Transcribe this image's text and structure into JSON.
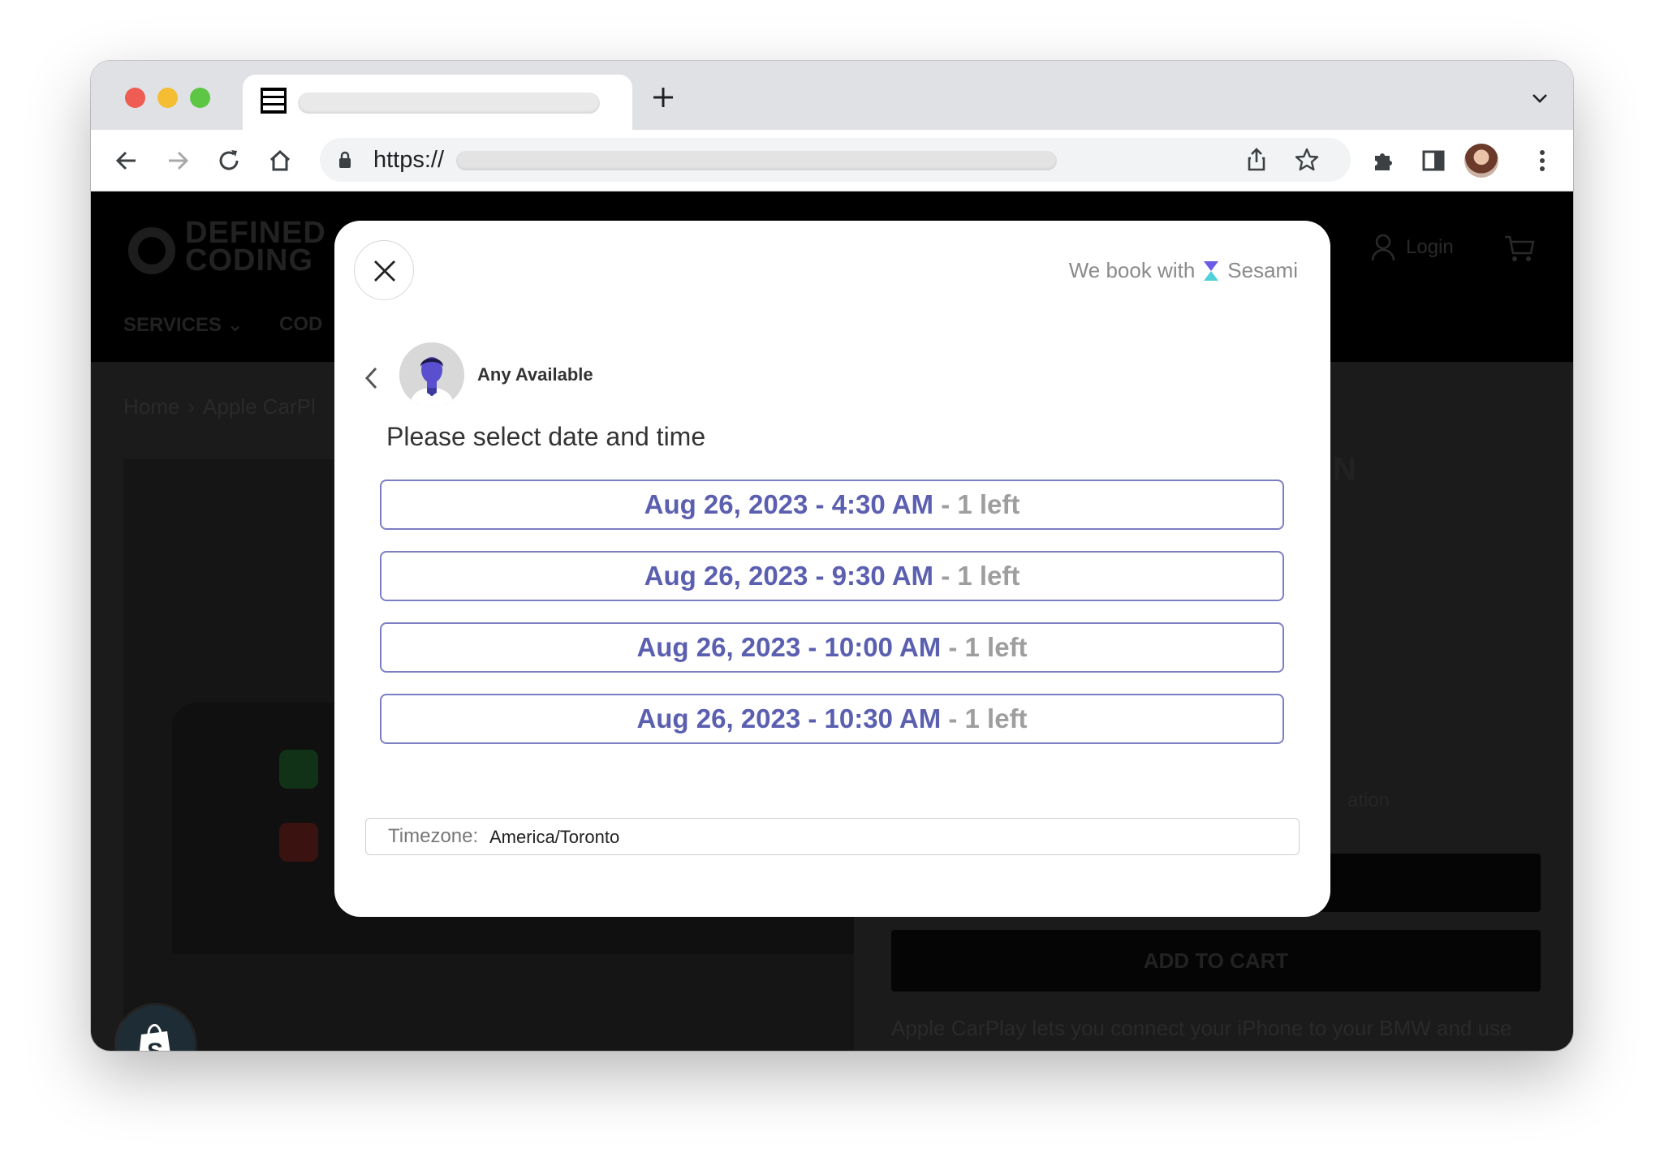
{
  "browser": {
    "url_prefix": "https://",
    "icons": {
      "back": "arrow-left-icon",
      "forward": "arrow-right-icon",
      "reload": "reload-icon",
      "home": "home-icon",
      "share": "share-icon",
      "bookmark": "star-icon",
      "extensions": "puzzle-icon",
      "sidepanel": "sidepanel-icon",
      "menu": "kebab-menu-icon"
    }
  },
  "page": {
    "logo_line1": "DEFINED",
    "logo_line2": "CODING",
    "nav": [
      "SERVICES ⌄",
      "COD"
    ],
    "login_label": "Login",
    "breadcrumb": [
      "Home",
      "Apple CarPl"
    ],
    "heading_fragment": "N",
    "text_fragment": "ation",
    "add_to_cart_label": "ADD TO CART",
    "description": "Apple CarPlay lets you connect your iPhone to your BMW and use"
  },
  "modal": {
    "book_with_prefix": "We book with",
    "book_with_brand": "Sesami",
    "staff_name": "Any Available",
    "heading": "Please select date and time",
    "slots": [
      {
        "time": "Aug 26, 2023 - 4:30 AM",
        "availability": " - 1 left"
      },
      {
        "time": "Aug 26, 2023 - 9:30 AM",
        "availability": " - 1 left"
      },
      {
        "time": "Aug 26, 2023 - 10:00 AM",
        "availability": " - 1 left"
      },
      {
        "time": "Aug 26, 2023 - 10:30 AM",
        "availability": " - 1 left"
      }
    ],
    "timezone_label": "Timezone:",
    "timezone_value": "America/Toronto"
  },
  "colors": {
    "slot_text": "#5b5fb0",
    "slot_border": "#7b7fc2",
    "availability_text": "#9e9e9e"
  }
}
